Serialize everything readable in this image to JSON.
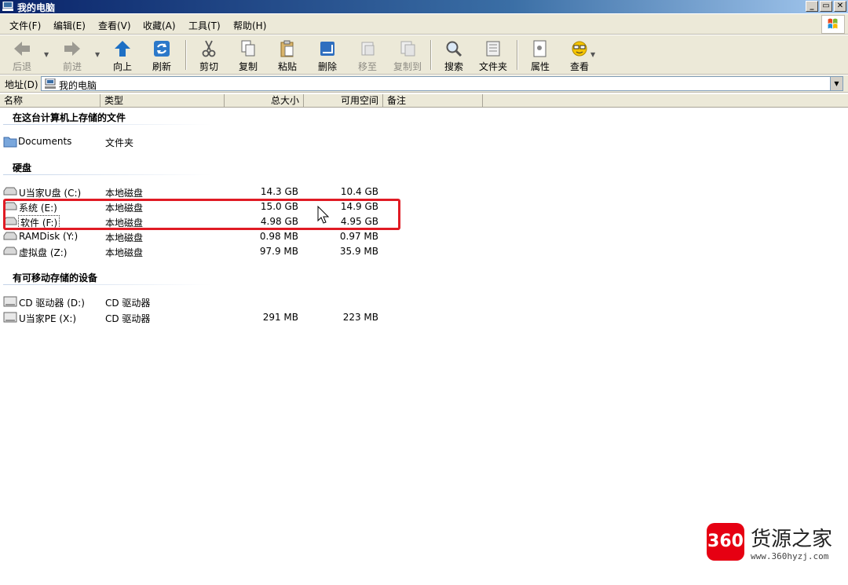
{
  "window": {
    "title": "我的电脑",
    "controls": [
      "_",
      "▭",
      "✕"
    ]
  },
  "menu": {
    "items": [
      "文件(F)",
      "编辑(E)",
      "查看(V)",
      "收藏(A)",
      "工具(T)",
      "帮助(H)"
    ]
  },
  "toolbar": {
    "back": "后退",
    "forward": "前进",
    "up": "向上",
    "refresh": "刷新",
    "cut": "剪切",
    "copy": "复制",
    "paste": "粘贴",
    "delete": "删除",
    "move_to": "移至",
    "copy_to": "复制到",
    "search": "搜索",
    "folders": "文件夹",
    "properties": "属性",
    "views": "查看"
  },
  "address": {
    "label": "地址(D)",
    "value": "我的电脑"
  },
  "columns": [
    "名称",
    "类型",
    "总大小",
    "可用空间",
    "备注"
  ],
  "groups": {
    "stored_files": {
      "title": "在这台计算机上存储的文件",
      "items": [
        {
          "name": "Documents",
          "type": "文件夹",
          "total": "",
          "free": ""
        }
      ]
    },
    "hard_disks": {
      "title": "硬盘",
      "items": [
        {
          "name": "U当家U盘 (C:)",
          "type": "本地磁盘",
          "total": "14.3 GB",
          "free": "10.4 GB"
        },
        {
          "name": "系统 (E:)",
          "type": "本地磁盘",
          "total": "15.0 GB",
          "free": "14.9 GB"
        },
        {
          "name": "软件 (F:)",
          "type": "本地磁盘",
          "total": "4.98 GB",
          "free": "4.95 GB"
        },
        {
          "name": "RAMDisk (Y:)",
          "type": "本地磁盘",
          "total": "0.98 MB",
          "free": "0.97 MB"
        },
        {
          "name": "虚拟盘 (Z:)",
          "type": "本地磁盘",
          "total": "97.9 MB",
          "free": "35.9 MB"
        }
      ]
    },
    "removable": {
      "title": "有可移动存储的设备",
      "items": [
        {
          "name": "CD 驱动器 (D:)",
          "type": "CD 驱动器",
          "total": "",
          "free": ""
        },
        {
          "name": "U当家PE (X:)",
          "type": "CD 驱动器",
          "total": "291 MB",
          "free": "223 MB"
        }
      ]
    }
  },
  "watermark": {
    "badge": "360",
    "name": "货源之家",
    "url": "www.360hyzj.com"
  },
  "colors": {
    "highlight": "#e01b24",
    "titlebar": "#0a246a",
    "chrome": "#ece9d8"
  }
}
